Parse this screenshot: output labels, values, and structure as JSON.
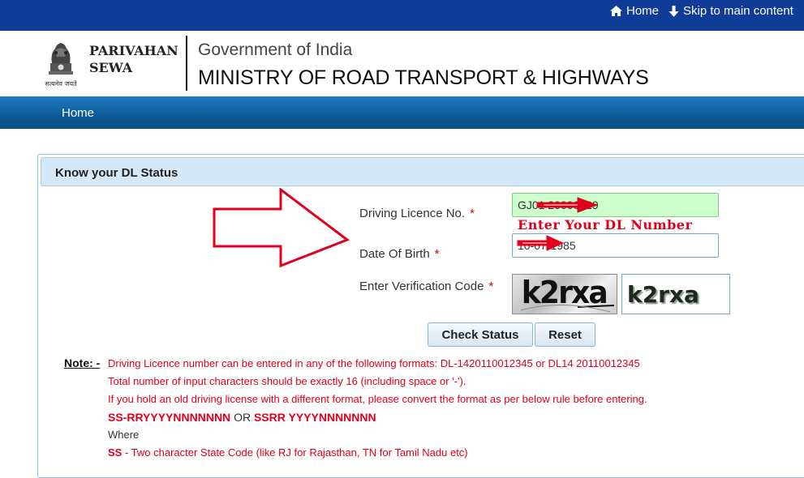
{
  "topbar": {
    "home_label": "Home",
    "skip_label": "Skip to main content"
  },
  "header": {
    "brand_line1": "PARIVAHAN",
    "brand_line2": "SEWA",
    "emblem_caption": "सत्यमेव जयते",
    "gov_title": "Government of India",
    "ministry_title": "MINISTRY OF ROAD TRANSPORT & HIGHWAYS"
  },
  "nav": {
    "home_label": "Home"
  },
  "panel": {
    "title": "Know your DL Status"
  },
  "form": {
    "dl_label": "Driving Licence No.",
    "dl_value": "GJ01 20000029",
    "dl_hint": "Enter Your DL Number",
    "dob_label": "Date Of Birth",
    "dob_value": "10-07-1985",
    "captcha_label": "Enter Verification Code",
    "captcha_image_text": "k2rxa",
    "captcha_value": "k2rxa",
    "required_mark": "*"
  },
  "buttons": {
    "check_status": "Check Status",
    "reset": "Reset"
  },
  "notes": {
    "label": "Note: -",
    "line1": "Driving Licence number can be entered in any of the following formats: DL-1420110012345 or DL14 20110012345",
    "line2": "Total number of input characters should be exactly 16 (including space or '-').",
    "line3": "If you hold an old driving license with a different format, please convert the format as per below rule before entering.",
    "line4_part1": "SS-RRYYYYNNNNNNN",
    "line4_or": "OR",
    "line4_part2": "SSRR YYYYNNNNNNN",
    "line5": "Where",
    "line6_code": "SS",
    "line6_text": "- Two character State Code (like RJ for Rajasthan, TN for Tamil Nadu etc)"
  },
  "colors": {
    "topbar": "#0f3c96",
    "nav": "#0b5a95",
    "accent_red": "#e0001b",
    "dl_field_bg": "#ccffcc"
  }
}
